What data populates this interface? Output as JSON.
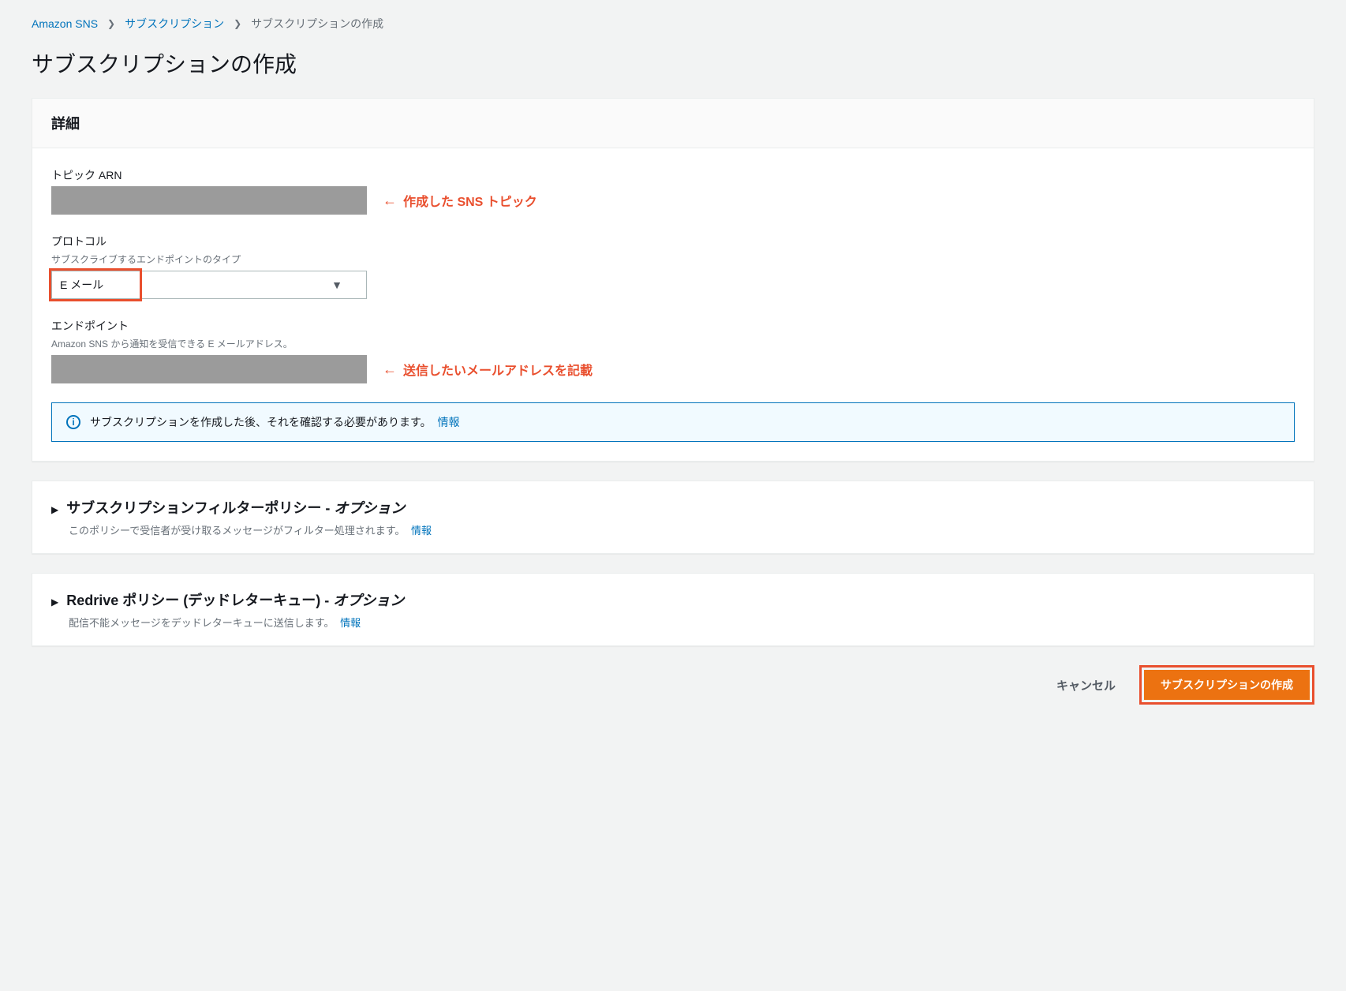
{
  "breadcrumb": {
    "root": "Amazon SNS",
    "mid": "サブスクリプション",
    "current": "サブスクリプションの作成"
  },
  "page_title": "サブスクリプションの作成",
  "detail_panel": {
    "header": "詳細",
    "topic_arn_label": "トピック ARN",
    "topic_arn_annotation": "作成した SNS トピック",
    "protocol_label": "プロトコル",
    "protocol_help": "サブスクライブするエンドポイントのタイプ",
    "protocol_value": "E メール",
    "endpoint_label": "エンドポイント",
    "endpoint_help": "Amazon SNS から通知を受信できる E メールアドレス。",
    "endpoint_annotation": "送信したいメールアドレスを記載",
    "info_text": "サブスクリプションを作成した後、それを確認する必要があります。",
    "info_link": "情報"
  },
  "filter_panel": {
    "title_main": "サブスクリプションフィルターポリシー - ",
    "title_em": "オプション",
    "desc": "このポリシーで受信者が受け取るメッセージがフィルター処理されます。",
    "info_link": "情報"
  },
  "redrive_panel": {
    "title_main": "Redrive ポリシー (デッドレターキュー) - ",
    "title_em": "オプション",
    "desc": "配信不能メッセージをデッドレターキューに送信します。",
    "info_link": "情報"
  },
  "footer": {
    "cancel": "キャンセル",
    "submit": "サブスクリプションの作成"
  }
}
